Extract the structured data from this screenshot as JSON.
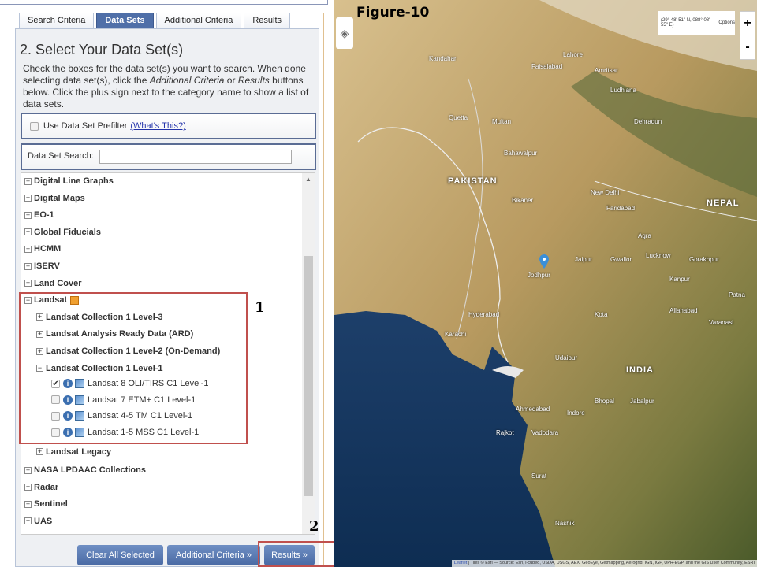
{
  "tabs": [
    "Search Criteria",
    "Data Sets",
    "Additional Criteria",
    "Results"
  ],
  "panel": {
    "title": "2. Select Your Data Set(s)",
    "instructions_1": "Check the boxes for the data set(s) you want to search. When done selecting data set(s), click the ",
    "instructions_em1": "Additional Criteria",
    "instructions_2": " or ",
    "instructions_em2": "Results",
    "instructions_3": " buttons below. Click the plus sign next to the category name to show a list of data sets.",
    "prefilter_label": "Use Data Set Prefilter",
    "prefilter_link": "(What's This?)",
    "search_label": "Data Set Search:",
    "search_value": ""
  },
  "tree": {
    "top": [
      "Digital Line Graphs",
      "Digital Maps",
      "EO-1",
      "Global Fiducials",
      "HCMM",
      "ISERV",
      "Land Cover"
    ],
    "landsat": "Landsat",
    "landsat_children": [
      "Landsat Collection 1 Level-3",
      "Landsat Analysis Ready Data (ARD)",
      "Landsat Collection 1 Level-2 (On-Demand)",
      "Landsat Collection 1 Level-1"
    ],
    "level1_datasets": [
      {
        "label": "Landsat 8 OLI/TIRS C1 Level-1",
        "checked": true
      },
      {
        "label": "Landsat 7 ETM+ C1 Level-1",
        "checked": false
      },
      {
        "label": "Landsat 4-5 TM C1 Level-1",
        "checked": false
      },
      {
        "label": "Landsat 1-5 MSS C1 Level-1",
        "checked": false
      }
    ],
    "landsat_legacy": "Landsat Legacy",
    "bottom": [
      "NASA LPDAAC Collections",
      "Radar",
      "Sentinel",
      "UAS"
    ]
  },
  "buttons": {
    "clear": "Clear All Selected",
    "additional": "Additional Criteria »",
    "results": "Results »"
  },
  "annotations": {
    "one": "1",
    "two": "2",
    "figure": "Figure-10"
  },
  "map": {
    "coords": "(29° 48' 51\" N, 088° 08' 55\" E)",
    "options": "Options",
    "zoom_in": "+",
    "zoom_out": "-",
    "attribution_link": "Leaflet",
    "attribution": " | Tiles © Esri — Source: Esri, i-cubed, USDA, USGS, AEX, GeoEye, Getmapping, Aerogrid, IGN, IGP, UPR-EGP, and the GIS User Community, ESRI",
    "countries": [
      "PAKISTAN",
      "INDIA",
      "NEPAL"
    ],
    "cities": [
      "Kandahar",
      "Quetta",
      "Faisalabad",
      "Lahore",
      "Amritsar",
      "Ludhiana",
      "Multan",
      "Bahawalpur",
      "Dehradun",
      "New Delhi",
      "Faridabad",
      "Bikaner",
      "Jaipur",
      "Agra",
      "Lucknow",
      "Kanpur",
      "Gorakhpur",
      "Jodhpur",
      "Gwalior",
      "Allahabad",
      "Varanasi",
      "Patna",
      "Hyderabad",
      "Karachi",
      "Udaipur",
      "Ahmedabad",
      "Vadodara",
      "Rajkot",
      "Bhopal",
      "Indore",
      "Jabalpur",
      "Surat",
      "Nashik",
      "Kota"
    ]
  }
}
